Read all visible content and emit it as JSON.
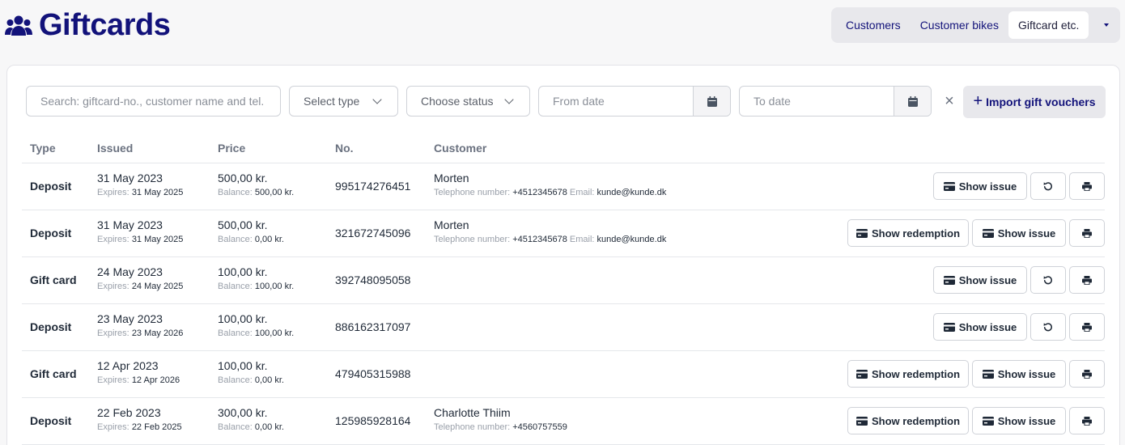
{
  "header": {
    "title": "Giftcards",
    "title_icon": "users-icon"
  },
  "nav": {
    "tabs": [
      {
        "label": "Customers",
        "active": false
      },
      {
        "label": "Customer bikes",
        "active": false
      },
      {
        "label": "Giftcard etc.",
        "active": true
      }
    ],
    "more_icon": "caret-down-icon"
  },
  "filters": {
    "search_placeholder": "Search: giftcard-no., customer name and tel. no",
    "type_select": "Select type",
    "status_select": "Choose status",
    "from_date": "From date",
    "to_date": "To date",
    "import_label": "Import gift vouchers"
  },
  "table": {
    "columns": [
      "Type",
      "Issued",
      "Price",
      "No.",
      "Customer"
    ],
    "expires_label": "Expires:",
    "balance_label": "Balance:",
    "phone_label": "Telephone number:",
    "email_label": "Email:",
    "show_issue_label": "Show issue",
    "show_redemption_label": "Show redemption",
    "rows": [
      {
        "type": "Deposit",
        "issued": "31 May 2023",
        "expires": "31 May 2025",
        "price": "500,00 kr.",
        "balance": "500,00 kr.",
        "no": "995174276451",
        "customer": "Morten",
        "phone": "+4512345678",
        "email": "kunde@kunde.dk",
        "redeemed": false
      },
      {
        "type": "Deposit",
        "issued": "31 May 2023",
        "expires": "31 May 2025",
        "price": "500,00 kr.",
        "balance": "0,00 kr.",
        "no": "321672745096",
        "customer": "Morten",
        "phone": "+4512345678",
        "email": "kunde@kunde.dk",
        "redeemed": true
      },
      {
        "type": "Gift card",
        "issued": "24 May 2023",
        "expires": "24 May 2025",
        "price": "100,00 kr.",
        "balance": "100,00 kr.",
        "no": "392748095058",
        "customer": "",
        "phone": "",
        "email": "",
        "redeemed": false
      },
      {
        "type": "Deposit",
        "issued": "23 May 2023",
        "expires": "23 May 2026",
        "price": "100,00 kr.",
        "balance": "100,00 kr.",
        "no": "886162317097",
        "customer": "",
        "phone": "",
        "email": "",
        "redeemed": false
      },
      {
        "type": "Gift card",
        "issued": "12 Apr 2023",
        "expires": "12 Apr 2026",
        "price": "100,00 kr.",
        "balance": "0,00 kr.",
        "no": "479405315988",
        "customer": "",
        "phone": "",
        "email": "",
        "redeemed": true
      },
      {
        "type": "Deposit",
        "issued": "22 Feb 2023",
        "expires": "22 Feb 2025",
        "price": "300,00 kr.",
        "balance": "0,00 kr.",
        "no": "125985928164",
        "customer": "Charlotte Thiim",
        "phone": "+4560757559",
        "email": "",
        "redeemed": true
      }
    ]
  },
  "colors": {
    "brand": "#12127a",
    "muted": "#9aa0aa",
    "border": "#cfd2d8"
  }
}
